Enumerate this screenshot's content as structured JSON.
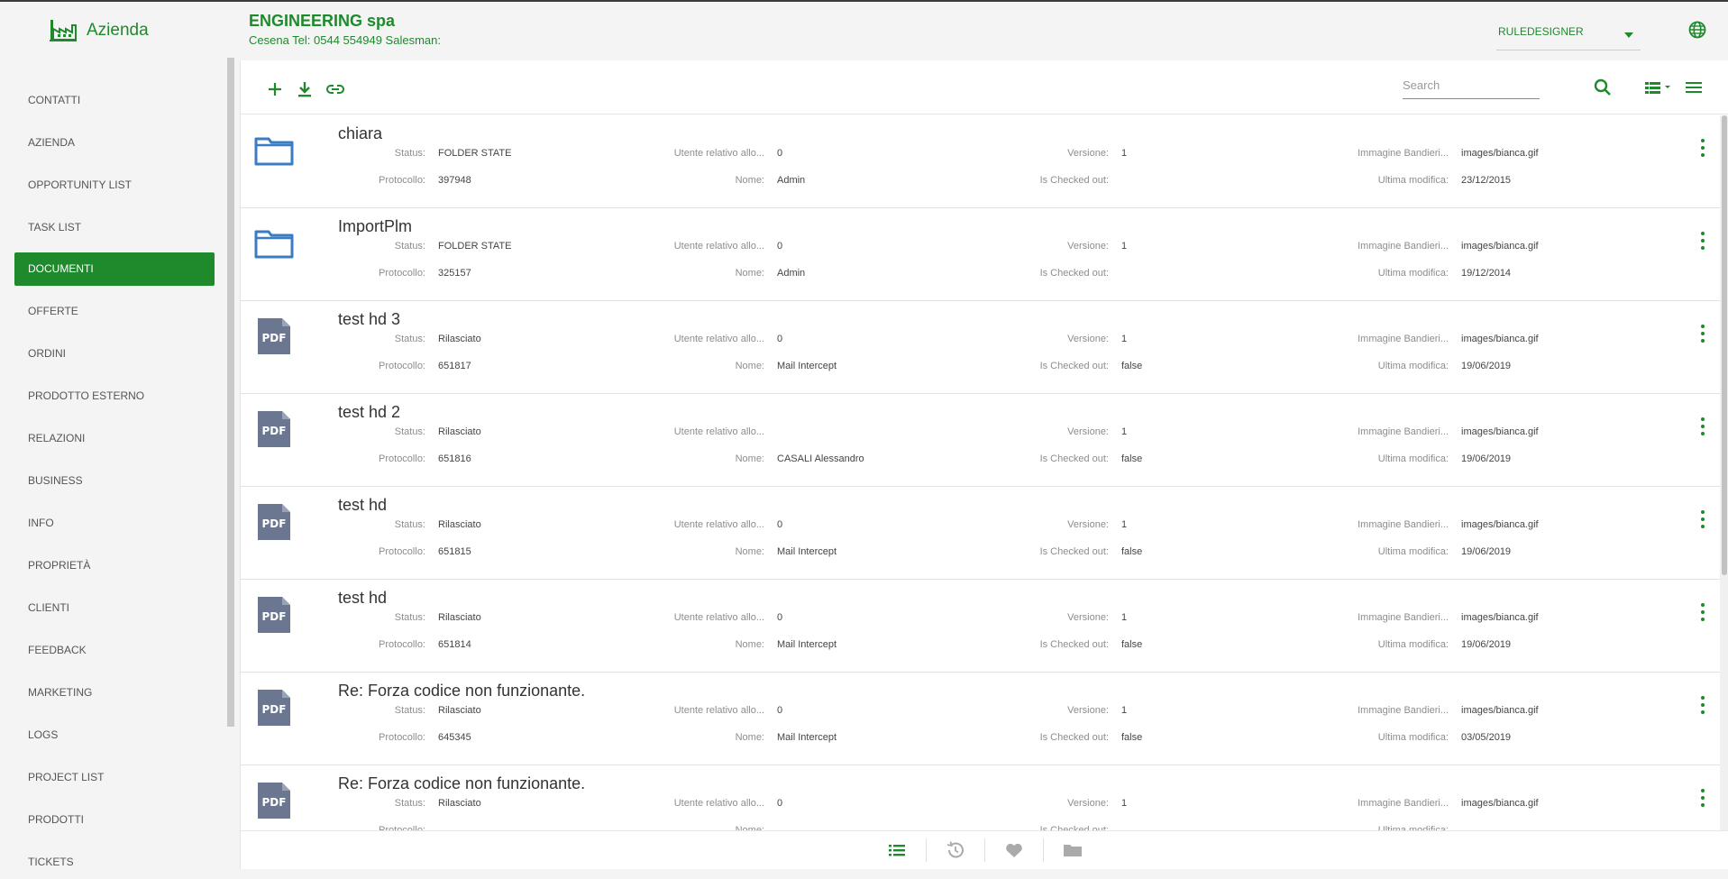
{
  "header": {
    "app_name": "Azienda",
    "company_name": "ENGINEERING spa",
    "company_sub": "Cesena Tel: 0544 554949 Salesman:",
    "user_select": "RULEDESIGNER"
  },
  "sidebar": {
    "items": [
      {
        "label": "CONTATTI"
      },
      {
        "label": "AZIENDA"
      },
      {
        "label": "OPPORTUNITY LIST"
      },
      {
        "label": "TASK LIST"
      },
      {
        "label": "DOCUMENTI"
      },
      {
        "label": "OFFERTE"
      },
      {
        "label": "ORDINI"
      },
      {
        "label": "PRODOTTO ESTERNO"
      },
      {
        "label": "RELAZIONI"
      },
      {
        "label": "BUSINESS"
      },
      {
        "label": "INFO"
      },
      {
        "label": "PROPRIETÀ"
      },
      {
        "label": "CLIENTI"
      },
      {
        "label": "FEEDBACK"
      },
      {
        "label": "MARKETING"
      },
      {
        "label": "LOGS"
      },
      {
        "label": "PROJECT LIST"
      },
      {
        "label": "PRODOTTI"
      },
      {
        "label": "TICKETS"
      }
    ],
    "active": "DOCUMENTI"
  },
  "toolbar": {
    "search_placeholder": "Search"
  },
  "labels": {
    "status": "Status:",
    "utente": "Utente relativo allo...",
    "versione": "Versione:",
    "immagine": "Immagine Bandieri...",
    "protocollo": "Protocollo:",
    "nome": "Nome:",
    "checked_out": "Is Checked out:",
    "ultima_modifica": "Ultima modifica:"
  },
  "rows": [
    {
      "type": "folder",
      "title": "chiara",
      "status": "FOLDER STATE",
      "utente": "0",
      "versione": "1",
      "immagine": "images/bianca.gif",
      "protocollo": "397948",
      "nome": "Admin",
      "checked_out": "",
      "ultima_modifica": "23/12/2015"
    },
    {
      "type": "folder",
      "title": "ImportPlm",
      "status": "FOLDER STATE",
      "utente": "0",
      "versione": "1",
      "immagine": "images/bianca.gif",
      "protocollo": "325157",
      "nome": "Admin",
      "checked_out": "",
      "ultima_modifica": "19/12/2014"
    },
    {
      "type": "pdf",
      "title": "test hd 3",
      "status": "Rilasciato",
      "utente": "0",
      "versione": "1",
      "immagine": "images/bianca.gif",
      "protocollo": "651817",
      "nome": "Mail Intercept",
      "checked_out": "false",
      "ultima_modifica": "19/06/2019"
    },
    {
      "type": "pdf",
      "title": "test hd 2",
      "status": "Rilasciato",
      "utente": "",
      "versione": "1",
      "immagine": "images/bianca.gif",
      "protocollo": "651816",
      "nome": "CASALI Alessandro",
      "checked_out": "false",
      "ultima_modifica": "19/06/2019"
    },
    {
      "type": "pdf",
      "title": "test hd",
      "status": "Rilasciato",
      "utente": "0",
      "versione": "1",
      "immagine": "images/bianca.gif",
      "protocollo": "651815",
      "nome": "Mail Intercept",
      "checked_out": "false",
      "ultima_modifica": "19/06/2019"
    },
    {
      "type": "pdf",
      "title": "test hd",
      "status": "Rilasciato",
      "utente": "0",
      "versione": "1",
      "immagine": "images/bianca.gif",
      "protocollo": "651814",
      "nome": "Mail Intercept",
      "checked_out": "false",
      "ultima_modifica": "19/06/2019"
    },
    {
      "type": "pdf",
      "title": "Re: Forza codice non funzionante.",
      "status": "Rilasciato",
      "utente": "0",
      "versione": "1",
      "immagine": "images/bianca.gif",
      "protocollo": "645345",
      "nome": "Mail Intercept",
      "checked_out": "false",
      "ultima_modifica": "03/05/2019"
    },
    {
      "type": "pdf",
      "title": "Re: Forza codice non funzionante.",
      "status": "Rilasciato",
      "utente": "0",
      "versione": "1",
      "immagine": "images/bianca.gif",
      "protocollo": "",
      "nome": "",
      "checked_out": "",
      "ultima_modifica": ""
    }
  ],
  "icons": {
    "app_logo": "factory-icon",
    "globe": "globe-icon",
    "add": "plus-icon",
    "download": "download-icon",
    "link": "link-icon",
    "search": "search-icon",
    "view": "list-view-icon",
    "menu": "hamburger-icon",
    "folder": "folder-icon",
    "pdf": "pdf-file-icon",
    "more": "more-vert-icon",
    "bottom": [
      "list-icon",
      "history-icon",
      "heart-icon",
      "folder-icon"
    ]
  },
  "colors": {
    "accent": "#1e8a2c",
    "folder": "#3a7cc4",
    "pdf": "#6b7791"
  }
}
